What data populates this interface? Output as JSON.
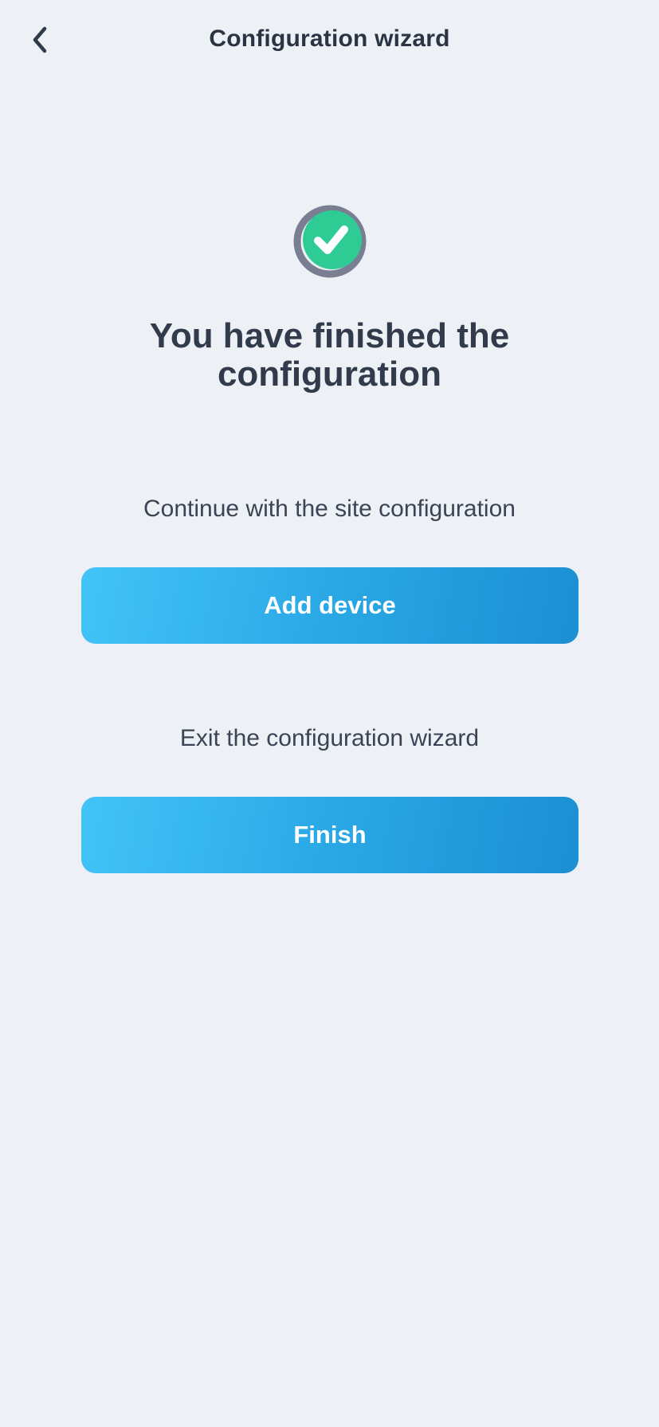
{
  "header": {
    "back_icon": "chevron-left-icon",
    "title": "Configuration wizard"
  },
  "status": {
    "icon": "check-circle-icon",
    "headline": "You have finished the configuration"
  },
  "actions": {
    "continue_prompt": "Continue with the site configuration",
    "add_device_label": "Add device",
    "exit_prompt": "Exit the configuration wizard",
    "finish_label": "Finish"
  },
  "colors": {
    "background": "#edf1f5",
    "text": "#2f3a4a",
    "button_gradient_start": "#42c4f7",
    "button_gradient_end": "#1b8fd2",
    "success_green": "#2fcb95",
    "ring_gray": "#7a7e93"
  }
}
